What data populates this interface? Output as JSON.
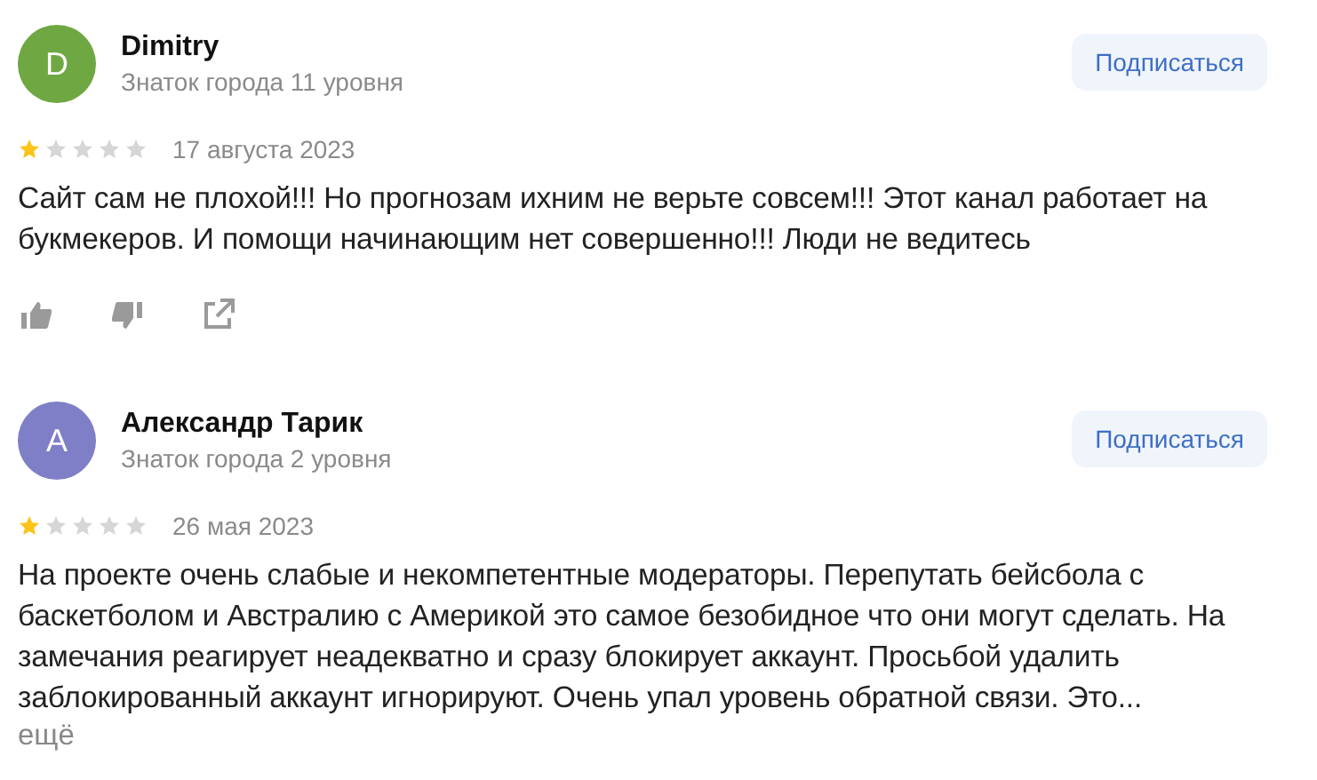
{
  "reviews": [
    {
      "initial": "D",
      "color": "#6fa843",
      "name": "Dimitry",
      "level": "Знаток города 11 уровня",
      "subscribe": "Подписаться",
      "stars": 1,
      "date": "17 августа 2023",
      "text": "Сайт сам не плохой!!! Но прогнозам ихним не верьте совсем!!! Этот канал работает на букмекеров. И помощи начинающим нет совершенно!!! Люди не ведитесь",
      "actions": true
    },
    {
      "initial": "А",
      "color": "#7f7fc8",
      "name": "Александр Тарик",
      "level": "Знаток города 2 уровня",
      "subscribe": "Подписаться",
      "stars": 1,
      "date": "26 мая 2023",
      "text": "На проекте очень слабые и некомпетентные модераторы. Перепутать бейсбола с баскетболом и Австралию с Америкой это самое безобидное что они могут сделать. На замечания реагирует неадекватно и сразу блокирует аккаунт. Просьбой удалить заблокированный аккаунт игнорируют. Очень упал уровень обратной связи. Это...",
      "more": "ещё"
    }
  ]
}
